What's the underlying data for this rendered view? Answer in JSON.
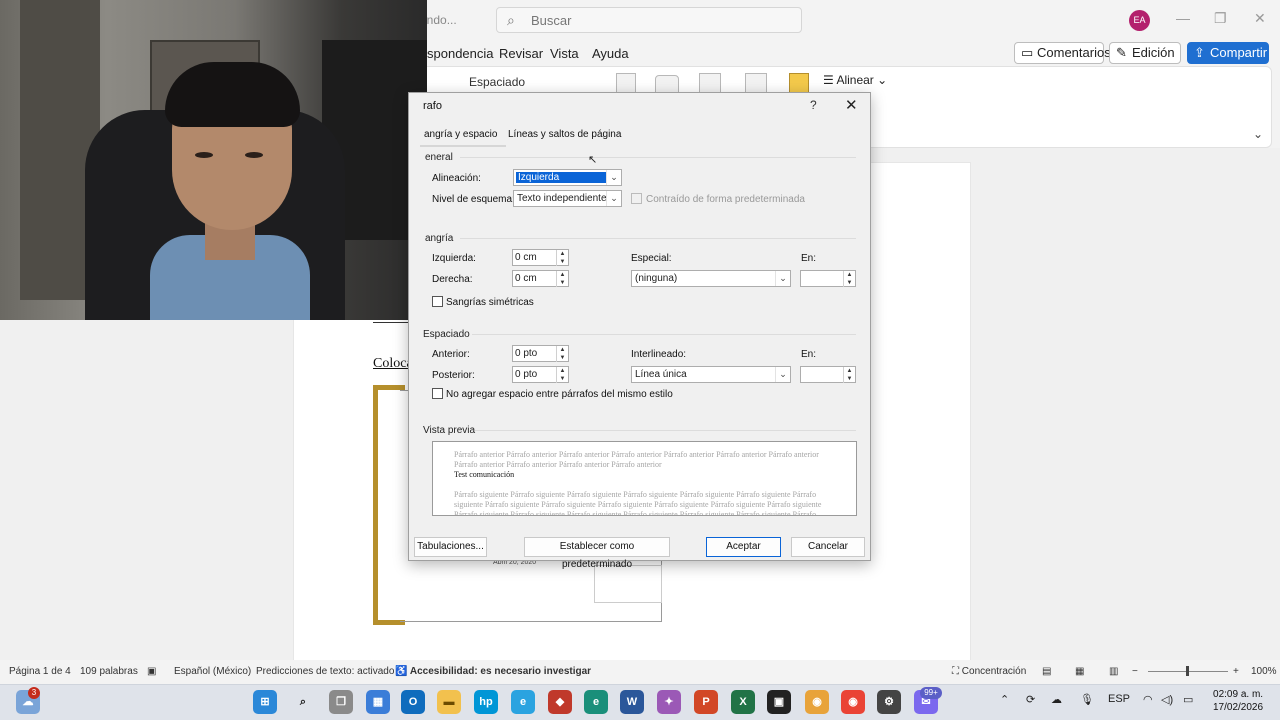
{
  "window": {
    "doc_name": "ando...",
    "search_placeholder": "Buscar",
    "user_initials": "EA"
  },
  "menu": {
    "items": [
      "spondencia",
      "Revisar",
      "Vista",
      "Ayuda"
    ],
    "comments_label": "Comentarios",
    "edit_label": "Edición",
    "share_label": "Compartir"
  },
  "ribbon": {
    "spacing_label": "Espaciado",
    "align_label": "Alinear"
  },
  "document": {
    "heading": "Coloca",
    "date": "Abril 20, 2020"
  },
  "dialog": {
    "title": "rafo",
    "help": "?",
    "close": "✕",
    "tabs": [
      "angría y espacio",
      "Líneas y saltos de página"
    ],
    "general": {
      "section": "eneral",
      "alignment_label": "Alineación:",
      "alignment_value": "Izquierda",
      "outline_label": "Nivel de esquema:",
      "outline_value": "Texto independiente",
      "collapsed_label": "Contraído de forma predeterminada"
    },
    "indent": {
      "section": "angría",
      "left_label": "Izquierda:",
      "left_value": "0 cm",
      "right_label": "Derecha:",
      "right_value": "0 cm",
      "special_label": "Especial:",
      "special_value": "(ninguna)",
      "by_label": "En:",
      "by_value": "",
      "mirror_label": "Sangrías simétricas"
    },
    "spacing": {
      "section": "Espaciado",
      "before_label": "Anterior:",
      "before_value": "0 pto",
      "after_label": "Posterior:",
      "after_value": "0 pto",
      "line_label": "Interlineado:",
      "line_value": "Línea única",
      "at_label": "En:",
      "at_value": "",
      "no_space_label": "No agregar espacio entre párrafos del mismo estilo"
    },
    "preview": {
      "section": "Vista previa",
      "prev_text": "Párrafo anterior Párrafo anterior Párrafo anterior Párrafo anterior Párrafo anterior Párrafo anterior Párrafo anterior Párrafo anterior Párrafo anterior Párrafo anterior Párrafo anterior",
      "main_text": "Test comunicación",
      "next_text": "Párrafo siguiente Párrafo siguiente Párrafo siguiente Párrafo siguiente Párrafo siguiente Párrafo siguiente Párrafo siguiente Párrafo siguiente Párrafo siguiente Párrafo siguiente Párrafo siguiente Párrafo siguiente Párrafo siguiente Párrafo siguiente Párrafo siguiente Párrafo siguiente Párrafo siguiente Párrafo siguiente Párrafo siguiente Párrafo siguiente Párrafo siguiente"
    },
    "buttons": {
      "tabs": "Tabulaciones...",
      "default": "Establecer como predeterminado",
      "ok": "Aceptar",
      "cancel": "Cancelar"
    }
  },
  "status": {
    "page": "Página 1 de 4",
    "words": "109 palabras",
    "language": "Español (México)",
    "predictions": "Predicciones de texto: activado",
    "accessibility": "Accesibilidad: es necesario investigar",
    "focus": "Concentración",
    "zoom": "100%"
  },
  "taskbar": {
    "weather_badge": "3",
    "notif_badge": "99+",
    "lang": "ESP",
    "time": "02:09 a. m.",
    "date": "17/02/2026"
  },
  "colors": {
    "accent": "#1f6fd1",
    "selection": "#0a64d7",
    "frame_gold": "#b58f2c"
  }
}
